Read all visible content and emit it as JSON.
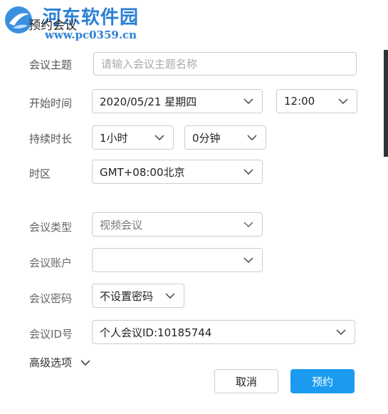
{
  "watermark": {
    "name": "河东软件园",
    "url": "www.pc0359.cn"
  },
  "dialog": {
    "title": "预约会议"
  },
  "form": {
    "topic": {
      "label": "会议主题",
      "placeholder": "请输入会议主题名称"
    },
    "start": {
      "label": "开始时间",
      "date": "2020/05/21 星期四",
      "time": "12:00"
    },
    "duration": {
      "label": "持续时长",
      "hours": "1小时",
      "minutes": "0分钟"
    },
    "timezone": {
      "label": "时区",
      "value": "GMT+08:00北京"
    },
    "type": {
      "label": "会议类型",
      "value": "视频会议"
    },
    "account": {
      "label": "会议账户",
      "value": ""
    },
    "password": {
      "label": "会议密码",
      "value": "不设置密码"
    },
    "meeting_id": {
      "label": "会议ID号",
      "value": "个人会议ID:10185744"
    }
  },
  "advanced": {
    "label": "高级选项"
  },
  "buttons": {
    "cancel": "取消",
    "book": "预约"
  },
  "colors": {
    "primary": "#1a9bf0",
    "watermark": "#2a7fd6"
  }
}
